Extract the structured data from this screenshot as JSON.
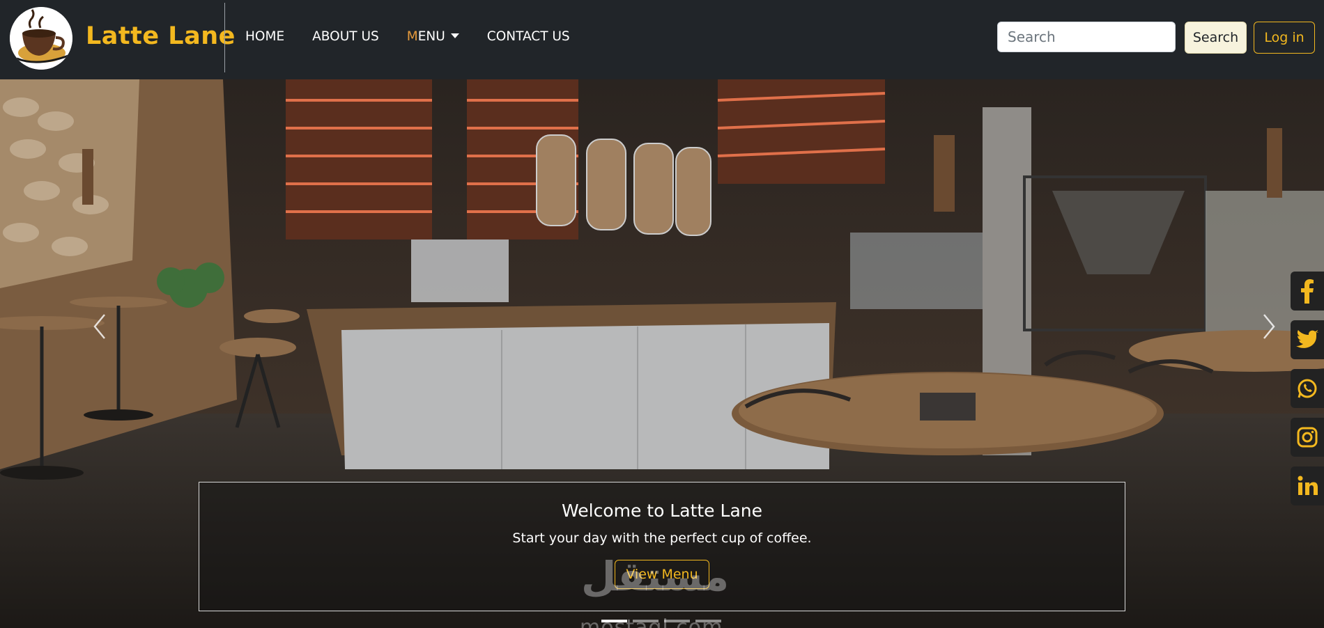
{
  "brand": {
    "name": "Latte Lane",
    "logo_icon": "coffee-cup-logo-icon"
  },
  "nav": {
    "items": [
      {
        "first": "H",
        "rest": "OME"
      },
      {
        "first": "",
        "rest": "ABOUT US"
      },
      {
        "first": "M",
        "rest": "ENU"
      },
      {
        "first": "",
        "rest": "CONTACT US"
      }
    ]
  },
  "search": {
    "placeholder": "Search",
    "button_label": "Search"
  },
  "login": {
    "label": "Log in"
  },
  "hero": {
    "title": "Welcome to Latte Lane",
    "subtitle": "Start your day with the perfect cup of coffee.",
    "button_label": "View Menu",
    "slides": 4,
    "active_slide": 1
  },
  "social": [
    "facebook-icon",
    "twitter-icon",
    "whatsapp-icon",
    "instagram-icon",
    "linkedin-icon"
  ],
  "watermark": {
    "latin": "mostaql.com",
    "arabic": "مستقل"
  },
  "colors": {
    "accent": "#f3b81f",
    "navbar": "#212529"
  }
}
